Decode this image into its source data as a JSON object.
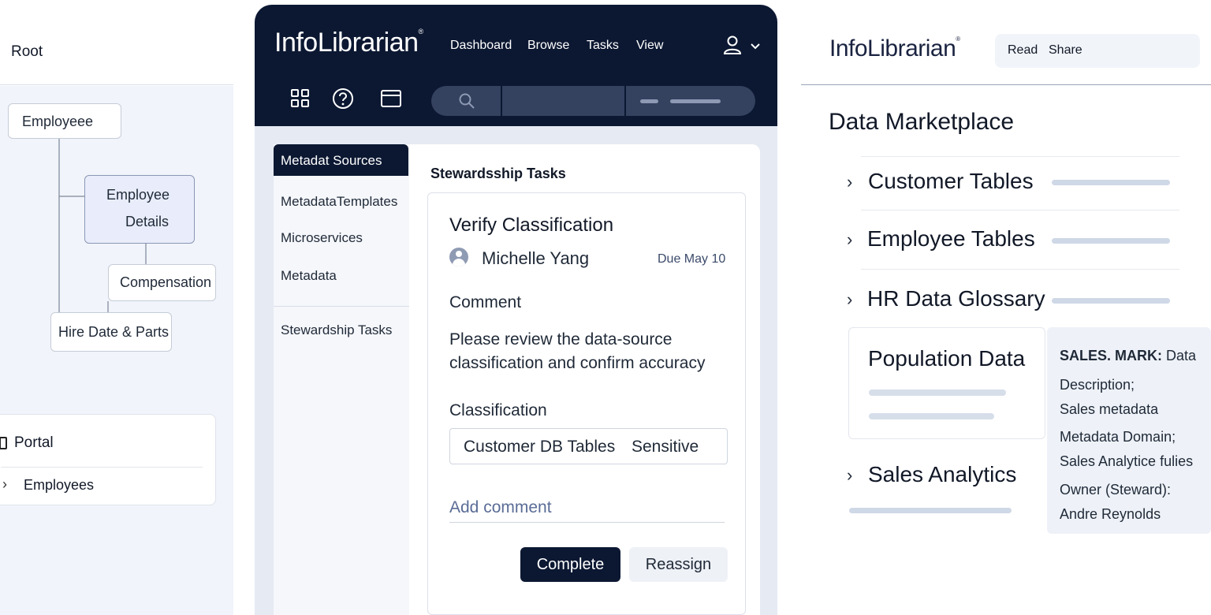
{
  "tree": {
    "root_label": "Root",
    "nodes": {
      "employee": "Employeee",
      "details_line1": "Employee",
      "details_line2": "Details",
      "compensation": "Compensation",
      "hire_date": "Hire Date & Parts"
    },
    "portal": {
      "title": "Portal",
      "item": "Employees"
    }
  },
  "app": {
    "brand": "InfoLibrarian",
    "nav": [
      "Dashboard",
      "Browse",
      "Tasks",
      "View"
    ],
    "sidebar": {
      "active": "Metadat Sources",
      "items": [
        "MetadataTemplates",
        "Microservices",
        "Metadata"
      ],
      "footer_item": "Stewardship Tasks"
    },
    "main": {
      "title": "Stewardsship Tasks",
      "task": {
        "title": "Verify Classification",
        "assignee": "Michelle Yang",
        "due": "Due May 10",
        "comment_label": "Comment",
        "comment_text": "Please review the data-source classification and confirm accuracy",
        "classification_label": "Classification",
        "classification_value": "Customer DB Tables",
        "classification_level": "Sensitive",
        "add_comment_placeholder": "Add comment",
        "complete_button": "Complete",
        "reassign_button": "Reassign"
      }
    },
    "colors": {
      "navy": "#0c1832",
      "panel_bg": "#e6eaf2",
      "accent_text": "#5a6c96"
    }
  },
  "marketplace": {
    "brand": "InfoLibrarian",
    "actions": {
      "read": "Read",
      "share": "Share"
    },
    "title": "Data Marketplace",
    "sections": [
      "Customer Tables",
      "Employee Tables",
      "HR Data Glossary"
    ],
    "population_card_title": "Population Data",
    "last_section": "Sales Analytics",
    "info": {
      "key": "SALES. MARK:",
      "key_value": "Data",
      "description_label": "Description;",
      "description_value": "Sales metadata",
      "domain_label": "Metadata Domain;",
      "domain_value": "Sales Analytice fulies",
      "owner_label": "Owner (Steward):",
      "owner_value": "Andre Reynolds"
    }
  }
}
